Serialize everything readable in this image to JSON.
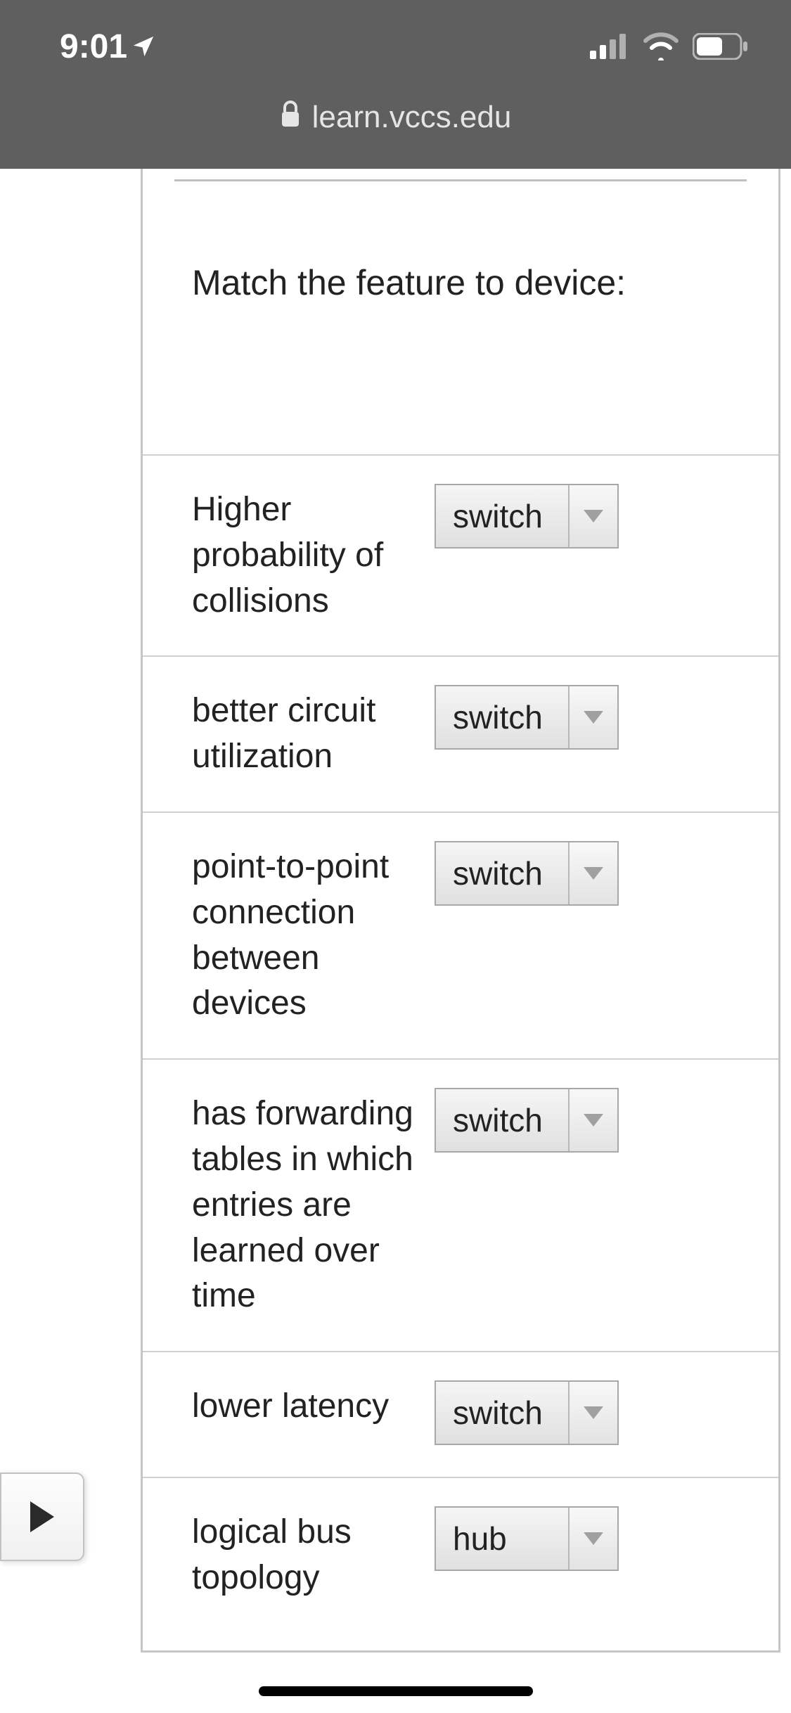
{
  "status": {
    "time": "9:01"
  },
  "browser": {
    "url": "learn.vccs.edu"
  },
  "quiz": {
    "question": "Match the feature to device:",
    "rows": [
      {
        "label": "Higher probability of collisions",
        "value": "switch"
      },
      {
        "label": "better circuit utilization",
        "value": "switch"
      },
      {
        "label": "point-to-point connection between devices",
        "value": "switch"
      },
      {
        "label": "has forwarding tables in which entries are learned over time",
        "value": "switch"
      },
      {
        "label": "lower latency",
        "value": "switch"
      },
      {
        "label": "logical bus topology",
        "value": "hub"
      }
    ]
  }
}
